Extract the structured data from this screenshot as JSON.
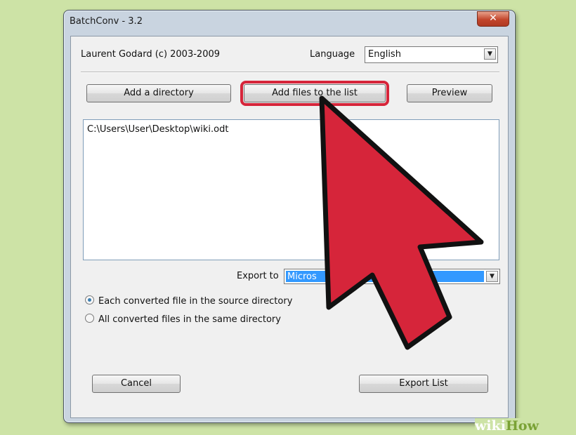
{
  "window": {
    "title": "BatchConv - 3.2",
    "close_label": "✕"
  },
  "header": {
    "copyright": "Laurent Godard (c) 2003-2009",
    "language_label": "Language",
    "language_value": "English"
  },
  "buttons": {
    "add_directory": "Add a directory",
    "add_files": "Add files to the list",
    "preview": "Preview",
    "cancel": "Cancel",
    "export_list": "Export List"
  },
  "file_list": {
    "items": [
      "C:\\Users\\User\\Desktop\\wiki.odt"
    ]
  },
  "export": {
    "label": "Export to",
    "selected_value": "Micros"
  },
  "options": {
    "each_in_source": "Each converted file in the source directory",
    "all_in_same": "All converted files in the same directory",
    "selected": "each_in_source"
  },
  "overlay": {
    "arrow_color": "#d6253a",
    "highlight_color": "#d6253a"
  },
  "watermark": {
    "part1": "wiki",
    "part2": "How"
  }
}
